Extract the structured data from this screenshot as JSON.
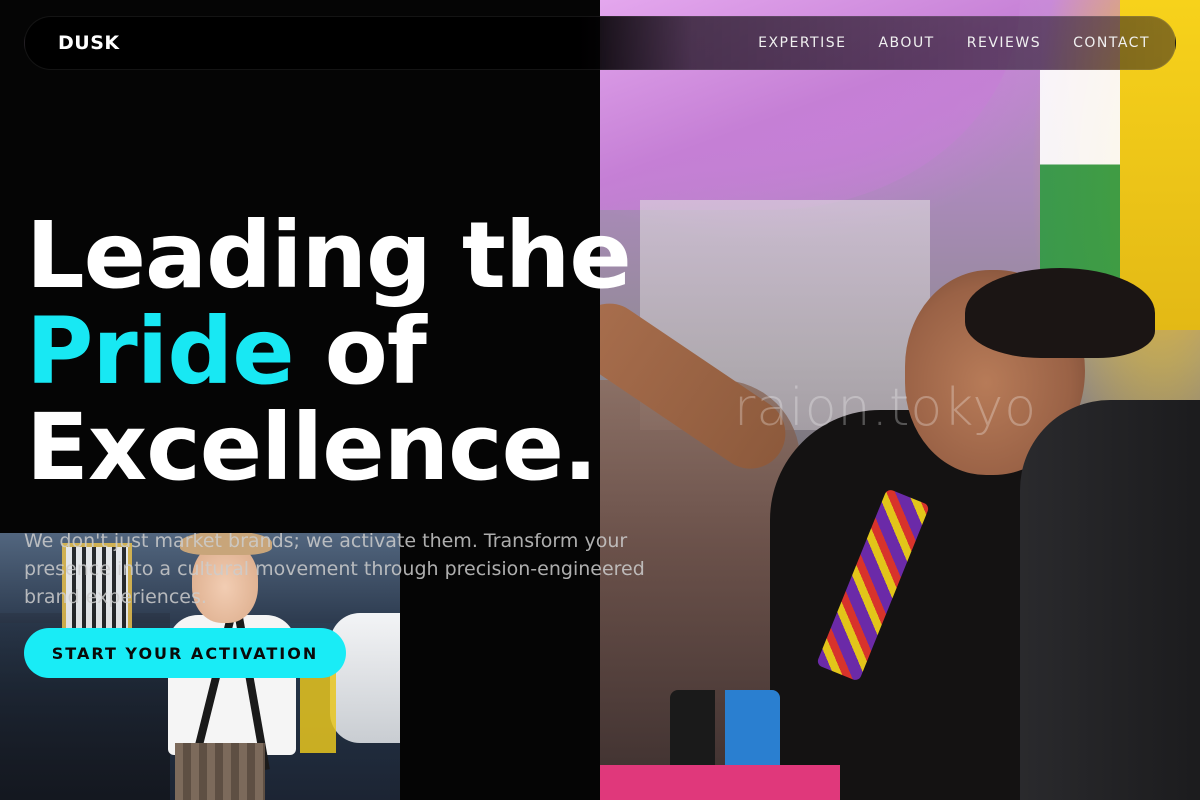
{
  "nav": {
    "brand": "DUSK",
    "links": [
      "EXPERTISE",
      "ABOUT",
      "REVIEWS",
      "CONTACT"
    ]
  },
  "hero": {
    "title_line1": "Leading the",
    "title_accent": "Pride",
    "title_line2_rest": " of",
    "title_line3": "Excellence.",
    "description": "We don't just market brands; we activate them. Transform your presence into a cultural movement through precision-engineered brand experiences.",
    "cta_label": "START YOUR ACTIVATION"
  },
  "media": {
    "watermark": "raion.tokyo"
  },
  "colors": {
    "accent": "#18e8f3",
    "background": "#050505",
    "text": "#ffffff"
  }
}
